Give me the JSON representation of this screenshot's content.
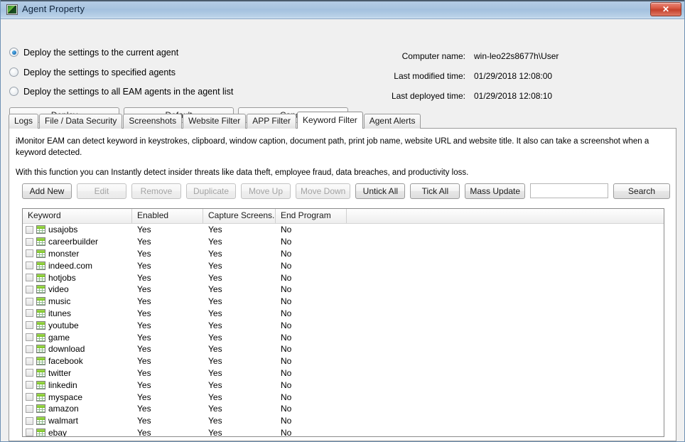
{
  "window": {
    "title": "Agent Property",
    "icon": "app-monitor-icon",
    "close_label": "✕"
  },
  "deploy_options": [
    {
      "label": "Deploy the settings to the current agent",
      "selected": true
    },
    {
      "label": "Deploy the settings to specified agents",
      "selected": false
    },
    {
      "label": "Deploy the settings to all EAM agents in the agent list",
      "selected": false
    }
  ],
  "info": [
    {
      "key": "Computer name:",
      "value": "win-leo22s8677h\\User"
    },
    {
      "key": "Last modified time:",
      "value": "01/29/2018 12:08:00"
    },
    {
      "key": "Last deployed time:",
      "value": "01/29/2018 12:08:10"
    }
  ],
  "main_actions": [
    {
      "label": "Deploy",
      "enabled": true
    },
    {
      "label": "Default",
      "enabled": true
    },
    {
      "label": "Cancel",
      "enabled": true
    }
  ],
  "tabs": [
    {
      "label": "Logs",
      "active": false
    },
    {
      "label": "File / Data Security",
      "active": false
    },
    {
      "label": "Screenshots",
      "active": false
    },
    {
      "label": "Website Filter",
      "active": false
    },
    {
      "label": "APP Filter",
      "active": false
    },
    {
      "label": "Keyword Filter",
      "active": true
    },
    {
      "label": "Agent Alerts",
      "active": false
    }
  ],
  "description": {
    "paragraph1": "iMonitor EAM can detect keyword in keystrokes, clipboard, window caption, document path, print job name, website URL and website title. It also can take a screenshot when a keyword detected.",
    "paragraph2": "With this function you can Instantly detect insider threats like data theft, employee fraud, data breaches, and productivity loss."
  },
  "toolbar": {
    "buttons": [
      {
        "label": "Add New",
        "enabled": true
      },
      {
        "label": "Edit",
        "enabled": false
      },
      {
        "label": "Remove",
        "enabled": false
      },
      {
        "label": "Duplicate",
        "enabled": false
      },
      {
        "label": "Move Up",
        "enabled": false
      },
      {
        "label": "Move Down",
        "enabled": false
      },
      {
        "label": "Untick All",
        "enabled": true
      },
      {
        "label": "Tick All",
        "enabled": true
      },
      {
        "label": "Mass Update",
        "enabled": true
      }
    ],
    "search_value": "",
    "search_placeholder": "",
    "search_label": "Search"
  },
  "grid": {
    "columns": [
      "Keyword",
      "Enabled",
      "Capture Screens...",
      "End Program",
      ""
    ],
    "rows": [
      {
        "keyword": "usajobs",
        "enabled": "Yes",
        "capture": "Yes",
        "end_program": "No",
        "ticked": false
      },
      {
        "keyword": "careerbuilder",
        "enabled": "Yes",
        "capture": "Yes",
        "end_program": "No",
        "ticked": false
      },
      {
        "keyword": "monster",
        "enabled": "Yes",
        "capture": "Yes",
        "end_program": "No",
        "ticked": false
      },
      {
        "keyword": "indeed.com",
        "enabled": "Yes",
        "capture": "Yes",
        "end_program": "No",
        "ticked": false
      },
      {
        "keyword": "hotjobs",
        "enabled": "Yes",
        "capture": "Yes",
        "end_program": "No",
        "ticked": false
      },
      {
        "keyword": "video",
        "enabled": "Yes",
        "capture": "Yes",
        "end_program": "No",
        "ticked": false
      },
      {
        "keyword": "music",
        "enabled": "Yes",
        "capture": "Yes",
        "end_program": "No",
        "ticked": false
      },
      {
        "keyword": "itunes",
        "enabled": "Yes",
        "capture": "Yes",
        "end_program": "No",
        "ticked": false
      },
      {
        "keyword": "youtube",
        "enabled": "Yes",
        "capture": "Yes",
        "end_program": "No",
        "ticked": false
      },
      {
        "keyword": "game",
        "enabled": "Yes",
        "capture": "Yes",
        "end_program": "No",
        "ticked": false
      },
      {
        "keyword": "download",
        "enabled": "Yes",
        "capture": "Yes",
        "end_program": "No",
        "ticked": false
      },
      {
        "keyword": "facebook",
        "enabled": "Yes",
        "capture": "Yes",
        "end_program": "No",
        "ticked": false
      },
      {
        "keyword": "twitter",
        "enabled": "Yes",
        "capture": "Yes",
        "end_program": "No",
        "ticked": false
      },
      {
        "keyword": "linkedin",
        "enabled": "Yes",
        "capture": "Yes",
        "end_program": "No",
        "ticked": false
      },
      {
        "keyword": "myspace",
        "enabled": "Yes",
        "capture": "Yes",
        "end_program": "No",
        "ticked": false
      },
      {
        "keyword": "amazon",
        "enabled": "Yes",
        "capture": "Yes",
        "end_program": "No",
        "ticked": false
      },
      {
        "keyword": "walmart",
        "enabled": "Yes",
        "capture": "Yes",
        "end_program": "No",
        "ticked": false
      },
      {
        "keyword": "ebay",
        "enabled": "Yes",
        "capture": "Yes",
        "end_program": "No",
        "ticked": false
      }
    ]
  },
  "colors": {
    "titlebar_accent": "#a9c4e0",
    "close_button": "#d95a44",
    "icon_green": "#76c21f",
    "panel_bg": "#f0f0f0"
  }
}
